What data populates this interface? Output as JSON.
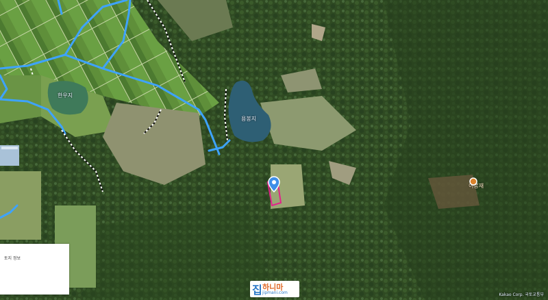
{
  "map": {
    "type": "satellite",
    "labels": {
      "reservoir_left": "한우지",
      "reservoir_center": "용봉지",
      "poi_name": "이봉재"
    },
    "info_card_text": "토지 정보",
    "copyright": "Kakao Corp. 국토교통부",
    "logo": {
      "glyph": "집",
      "brand": "하니마",
      "sub": "jipmani.com"
    },
    "colors": {
      "parcel_outline": "#e2238a",
      "road": "#3ea3ff",
      "pin": "#3f8fe8"
    },
    "icons": [
      "location-pin-icon",
      "poi-marker-icon"
    ]
  }
}
